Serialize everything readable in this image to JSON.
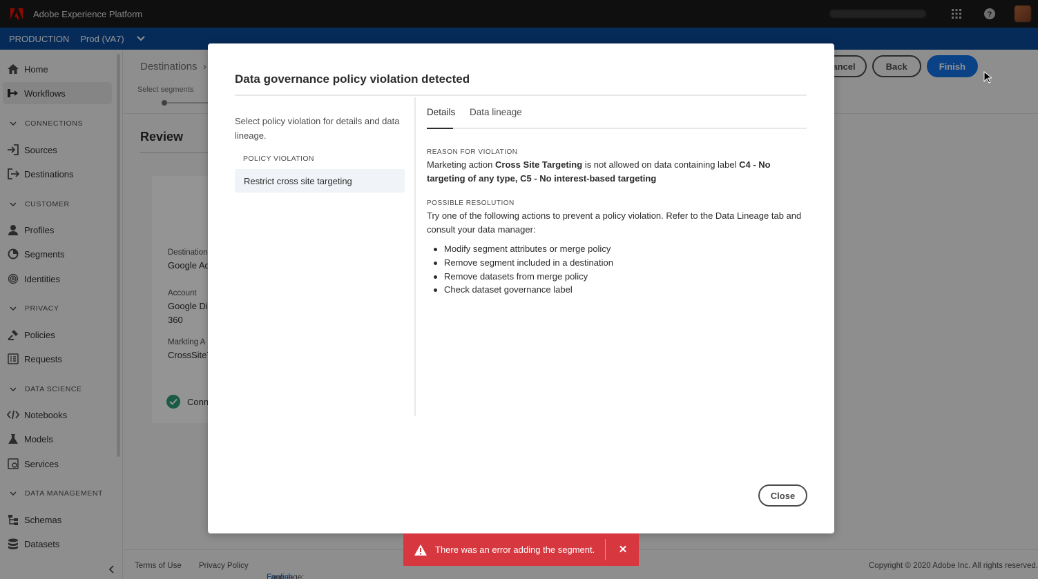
{
  "app": {
    "title": "Adobe Experience Platform"
  },
  "env": {
    "label": "PRODUCTION",
    "sandbox": "Prod (VA7)"
  },
  "sidebar": {
    "home": "Home",
    "workflows": "Workflows",
    "sections": {
      "connections": "CONNECTIONS",
      "customer": "CUSTOMER",
      "privacy": "PRIVACY",
      "data_science": "DATA SCIENCE",
      "data_management": "DATA MANAGEMENT"
    },
    "items": {
      "sources": "Sources",
      "destinations": "Destinations",
      "profiles": "Profiles",
      "segments": "Segments",
      "identities": "Identities",
      "policies": "Policies",
      "requests": "Requests",
      "notebooks": "Notebooks",
      "models": "Models",
      "services": "Services",
      "schemas": "Schemas",
      "datasets": "Datasets"
    }
  },
  "main": {
    "breadcrumb": "Destinations",
    "step_label": "Select segments",
    "review_title": "Review",
    "card": {
      "destination_label": "Destination",
      "destination_value": "Google Ad",
      "account_label": "Account",
      "account_value_1": "Google Di",
      "account_value_2": "360",
      "marketing_label": "Markting A",
      "marketing_value": "CrossSiteT",
      "status_text": "Conn"
    },
    "actions": {
      "cancel": "Cancel",
      "back": "Back",
      "finish": "Finish"
    }
  },
  "dialog": {
    "title": "Data governance policy violation detected",
    "intro": "Select policy violation for details and data lineage.",
    "violation_heading": "POLICY VIOLATION",
    "violation_item": "Restrict cross site targeting",
    "tabs": {
      "details": "Details",
      "lineage": "Data lineage"
    },
    "reason_heading": "REASON FOR VIOLATION",
    "reason": {
      "part1": "Marketing action ",
      "action": "Cross Site Targeting",
      "part2": " is not allowed on data containing label ",
      "labels": "C4 - No targeting of any type, C5 - No interest-based targeting"
    },
    "resolution_heading": "POSSIBLE RESOLUTION",
    "resolution_text": "Try one of the following actions to prevent a policy violation. Refer to the Data Lineage tab and consult your data manager:",
    "resolution_items": [
      "Modify segment attributes or merge policy",
      "Remove segment included in a destination",
      "Remove datasets from merge policy",
      "Check dataset governance label"
    ],
    "close": "Close"
  },
  "toast": {
    "message": "There was an error adding the segment."
  },
  "footer": {
    "terms": "Terms of Use",
    "privacy": "Privacy Policy",
    "language_label": "Language:",
    "language_value": "English",
    "copyright": "Copyright © 2020 Adobe Inc. All rights reserved."
  },
  "icons": {
    "adobe": "adobe-logo",
    "apps": "apps-grid-icon",
    "help": "help-icon",
    "home": "home-icon",
    "workflows": "workflows-icon",
    "sources": "sources-icon",
    "destinations": "destinations-icon",
    "profiles": "profiles-icon",
    "segments": "segments-icon",
    "identities": "identities-icon",
    "policies": "policies-icon",
    "requests": "requests-icon",
    "notebooks": "notebooks-icon",
    "models": "models-icon",
    "services": "services-icon",
    "schemas": "schemas-icon",
    "datasets": "datasets-icon",
    "warning": "warning-icon",
    "close": "close-icon"
  },
  "colors": {
    "accent": "#1473e6",
    "env_bar": "#0d4a9a",
    "error": "#d7373f",
    "success": "#2d9d78"
  }
}
